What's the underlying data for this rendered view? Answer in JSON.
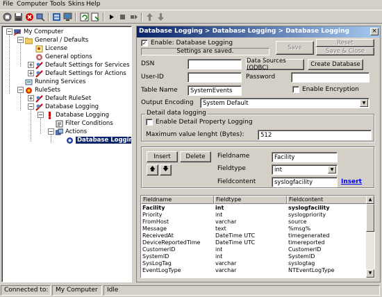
{
  "menu": {
    "items": [
      "File",
      "Computer",
      "Tools",
      "Skins",
      "Help"
    ]
  },
  "toolbar": {
    "buttons": [
      "stop-icon",
      "save-icon",
      "delete-icon",
      "connect-icon",
      "config-icon",
      "computer-icon",
      "refresh-icon",
      "export-icon",
      "play-icon",
      "stop-square-icon",
      "step-icon",
      "up-arrow-icon",
      "down-arrow-icon"
    ]
  },
  "tree": {
    "root": "My Computer",
    "general": "General / Defaults",
    "license": "License",
    "general_options": "General options",
    "default_services": "Default Settings for Services",
    "default_actions": "Default Settings for Actions",
    "running_services": "Running Services",
    "rulesets": "RuleSets",
    "default_ruleset": "Default RuleSet",
    "database_logging": "Database Logging",
    "database_logging_rule": "Database Logging",
    "filter_conditions": "Filter Conditions",
    "actions": "Actions",
    "database_logging_action": "Database Logging"
  },
  "panel": {
    "title": "Database Logging > Database Logging > Database Logging",
    "enable_label": "Enable: Database Logging",
    "enable_checked": true,
    "status_message": "Settings are saved.",
    "save_label": "Save",
    "reset_label": "Reset",
    "save_close_label": "Save & Close",
    "dsn_label": "DSN",
    "dsn_value": "",
    "datasources_button": "Data Sources (ODBC)",
    "create_db_button": "Create Database",
    "userid_label": "User-ID",
    "userid_value": "",
    "password_label": "Password",
    "password_value": "",
    "tablename_label": "Table Name",
    "tablename_value": "SystemEvents",
    "encryption_label": "Enable Encryption",
    "encryption_checked": false,
    "output_encoding_label": "Output Encoding",
    "output_encoding_value": "System Default",
    "detail_group_label": "Detail data logging",
    "detail_property_label": "Enable Detail Property Logging",
    "detail_property_checked": false,
    "max_value_label": "Maximum value lenght (Bytes):",
    "max_value": "512",
    "insert_button": "Insert",
    "delete_button": "Delete",
    "fieldname_label": "Fieldname",
    "fieldname_value": "Facility",
    "fieldtype_label": "Fieldtype",
    "fieldtype_value": "int",
    "fieldcontent_label": "Fieldcontent",
    "fieldcontent_value": "syslogfacility",
    "insert_link": "Insert"
  },
  "grid": {
    "headers": [
      "Fieldname",
      "Fieldtype",
      "Fieldcontent"
    ],
    "rows": [
      [
        "Facility",
        "int",
        "syslogfacility"
      ],
      [
        "Priority",
        "int",
        "syslogpriority"
      ],
      [
        "FromHost",
        "varchar",
        "source"
      ],
      [
        "Message",
        "text",
        "%msg%"
      ],
      [
        "ReceivedAt",
        "DateTime UTC",
        "timegenerated"
      ],
      [
        "DeviceReportedTime",
        "DateTime UTC",
        "timereported"
      ],
      [
        "CustomerID",
        "int",
        "CustomerID"
      ],
      [
        "SystemID",
        "int",
        "SystemID"
      ],
      [
        "SysLogTag",
        "varchar",
        "syslogtag"
      ],
      [
        "EventLogType",
        "varchar",
        "NTEventLogType"
      ]
    ]
  },
  "status": {
    "connected_label": "Connected to:",
    "computer": "My Computer",
    "state": "Idle"
  },
  "colors": {
    "title_gradient_start": "#0a246a",
    "title_gradient_end": "#a6caf0",
    "link": "#0000ff",
    "selection": "#0a246a"
  }
}
